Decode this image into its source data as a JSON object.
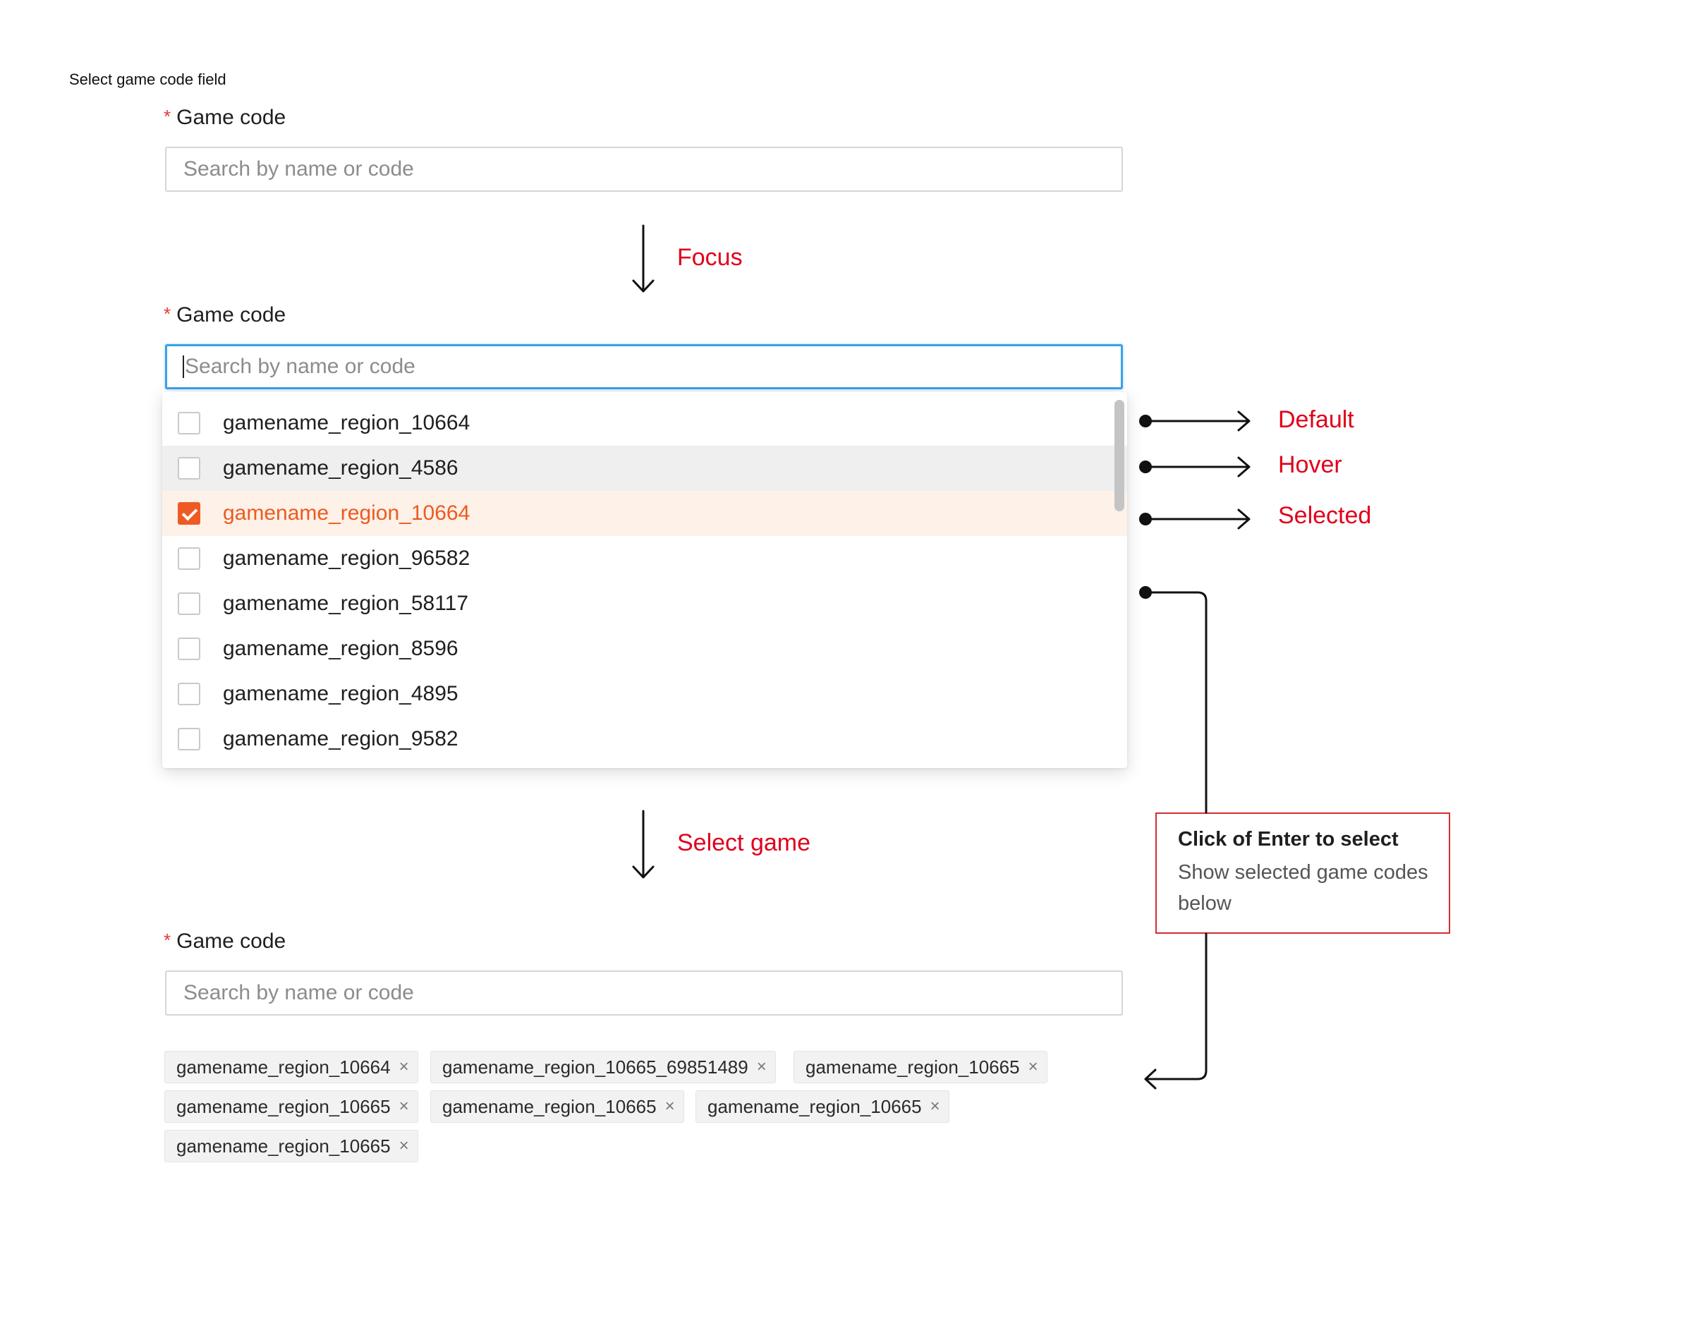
{
  "caption": "Select game code field",
  "field": {
    "required_mark": "*",
    "label": "Game code",
    "placeholder": "Search by name or code"
  },
  "steps": {
    "focus": "Focus",
    "select": "Select game"
  },
  "dropdown": {
    "options": [
      {
        "label": "gamename_region_10664",
        "state": "default",
        "checked": false
      },
      {
        "label": "gamename_region_4586",
        "state": "hover",
        "checked": false
      },
      {
        "label": "gamename_region_10664",
        "state": "selected",
        "checked": true
      },
      {
        "label": "gamename_region_96582",
        "state": "default",
        "checked": false
      },
      {
        "label": "gamename_region_58117",
        "state": "default",
        "checked": false
      },
      {
        "label": "gamename_region_8596",
        "state": "default",
        "checked": false
      },
      {
        "label": "gamename_region_4895",
        "state": "default",
        "checked": false
      },
      {
        "label": "gamename_region_9582",
        "state": "default",
        "checked": false
      }
    ]
  },
  "state_labels": {
    "default": "Default",
    "hover": "Hover",
    "selected": "Selected"
  },
  "note": {
    "title": "Click of Enter to select",
    "body": "Show selected game codes below"
  },
  "selected_tags": [
    "gamename_region_10664",
    "gamename_region_10665_69851489",
    "gamename_region_10665",
    "gamename_region_10665",
    "gamename_region_10665",
    "gamename_region_10665",
    "gamename_region_10665"
  ],
  "tag_remove_glyph": "×",
  "colors": {
    "annotation_red": "#e0001b",
    "selected_orange": "#ef5a23",
    "selected_bg": "#fdf1e8",
    "hover_bg": "#efefef",
    "focus_blue": "#3aa0ea"
  }
}
